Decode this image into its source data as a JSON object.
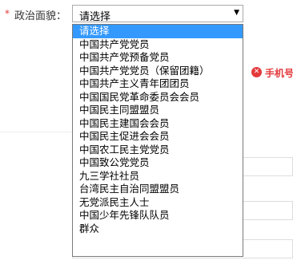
{
  "form": {
    "required_mark": "*",
    "field_label": "政治面貌：",
    "selected_value": "请选择",
    "arrow_icon": "dropdown-arrow",
    "options": [
      "请选择",
      "中国共产党党员",
      "中国共产党预备党员",
      "中国共产党党员（保留团籍）",
      "中国共产主义青年团团员",
      "中国国民党革命委员会会员",
      "中国民主同盟盟员",
      "中国民主建国会会员",
      "中国民主促进会会员",
      "中国农工民主党党员",
      "中国致公党党员",
      "九三学社社员",
      "台湾民主自治同盟盟员",
      "无党派民主人士",
      "中国少年先锋队队员",
      "群众"
    ],
    "highlighted_index": 0
  },
  "error": {
    "icon": "error-x-icon",
    "text": "手机号"
  },
  "colors": {
    "error": "#e4393c",
    "highlight": "#3399ff"
  }
}
